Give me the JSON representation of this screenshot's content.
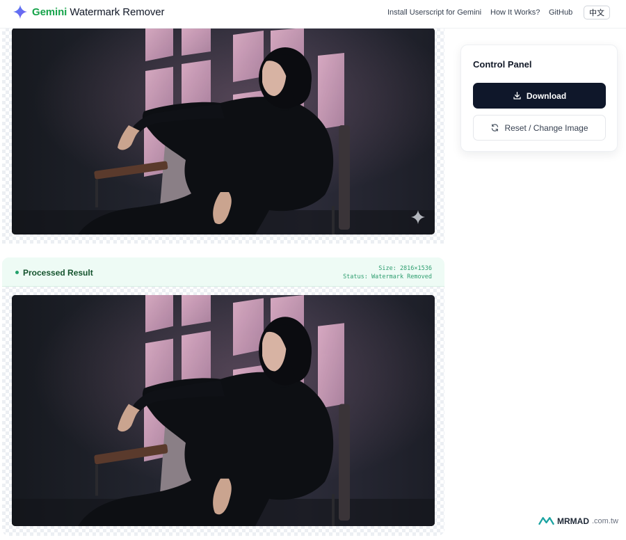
{
  "header": {
    "brand_accent": "Gemini",
    "brand_rest": "Watermark Remover",
    "nav": [
      "Install Userscript for Gemini",
      "How It Works?",
      "GitHub"
    ],
    "lang": "中文",
    "icon": "gemini-sparkle-icon"
  },
  "result": {
    "title": "Processed Result",
    "size": "Size: 2816×1536",
    "status": "Status: Watermark Removed"
  },
  "control": {
    "title": "Control Panel",
    "download": "Download",
    "reset": "Reset / Change Image",
    "download_icon": "download-icon",
    "reset_icon": "refresh-icon"
  },
  "footer": {
    "brand": "MRMAD",
    "domain": ".com.tw"
  },
  "colors": {
    "accent_green": "#16a34a",
    "primary_button": "#0f172a",
    "status_green": "#2f9e70"
  }
}
